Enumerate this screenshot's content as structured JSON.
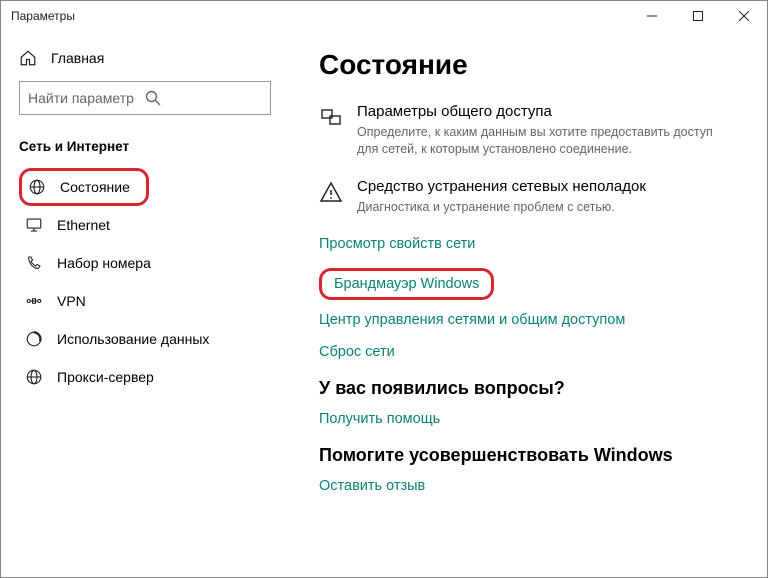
{
  "window": {
    "title": "Параметры"
  },
  "sidebar": {
    "home": "Главная",
    "search_placeholder": "Найти параметр",
    "section": "Сеть и Интернет",
    "items": [
      {
        "label": "Состояние"
      },
      {
        "label": "Ethernet"
      },
      {
        "label": "Набор номера"
      },
      {
        "label": "VPN"
      },
      {
        "label": "Использование данных"
      },
      {
        "label": "Прокси-сервер"
      }
    ]
  },
  "main": {
    "title": "Состояние",
    "blocks": [
      {
        "title": "Параметры общего доступа",
        "desc": "Определите, к каким данным вы хотите предоставить доступ для сетей, к которым установлено соединение."
      },
      {
        "title": "Средство устранения сетевых неполадок",
        "desc": "Диагностика и устранение проблем с сетью."
      }
    ],
    "links": [
      "Просмотр свойств сети",
      "Брандмауэр Windows",
      "Центр управления сетями и общим доступом",
      "Сброс сети"
    ],
    "q_title": "У вас появились вопросы?",
    "q_link": "Получить помощь",
    "f_title": "Помогите усовершенствовать Windows",
    "f_link": "Оставить отзыв"
  },
  "colors": {
    "accent": "#0a8471",
    "highlight": "#d4282e"
  }
}
